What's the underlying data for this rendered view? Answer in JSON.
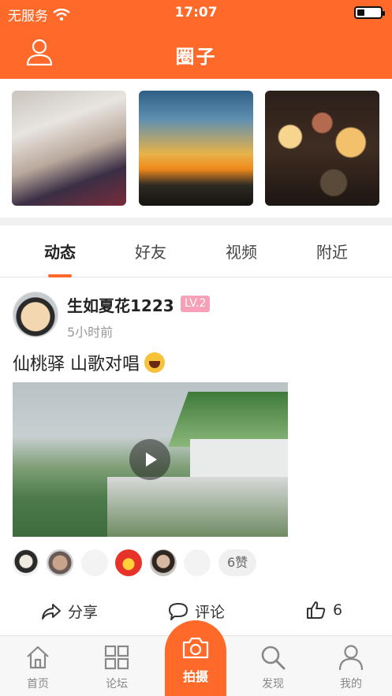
{
  "status": {
    "carrier": "无服务",
    "time": "17:07"
  },
  "header": {
    "title": "圈子"
  },
  "tabs": [
    "动态",
    "好友",
    "视频",
    "附近"
  ],
  "active_tab_index": 0,
  "post": {
    "username": "生如夏花1223",
    "level": "LV.2",
    "time_ago": "5小时前",
    "text": "仙桃驿 山歌对唱",
    "like_count_label": "6赞",
    "actions": {
      "share": "分享",
      "comment": "评论",
      "like_count": "6"
    }
  },
  "bottom_nav": {
    "home": "首页",
    "forum": "论坛",
    "camera": "拍摄",
    "discover": "发现",
    "mine": "我的"
  },
  "colors": {
    "brand": "#ff6a2b",
    "level_badge": "#f7a0b7"
  },
  "icons": [
    "wifi-icon",
    "battery-icon",
    "user-icon",
    "play-icon",
    "share-icon",
    "comment-icon",
    "thumbs-up-icon",
    "home-icon",
    "grid-icon",
    "camera-icon",
    "search-icon",
    "profile-icon"
  ]
}
